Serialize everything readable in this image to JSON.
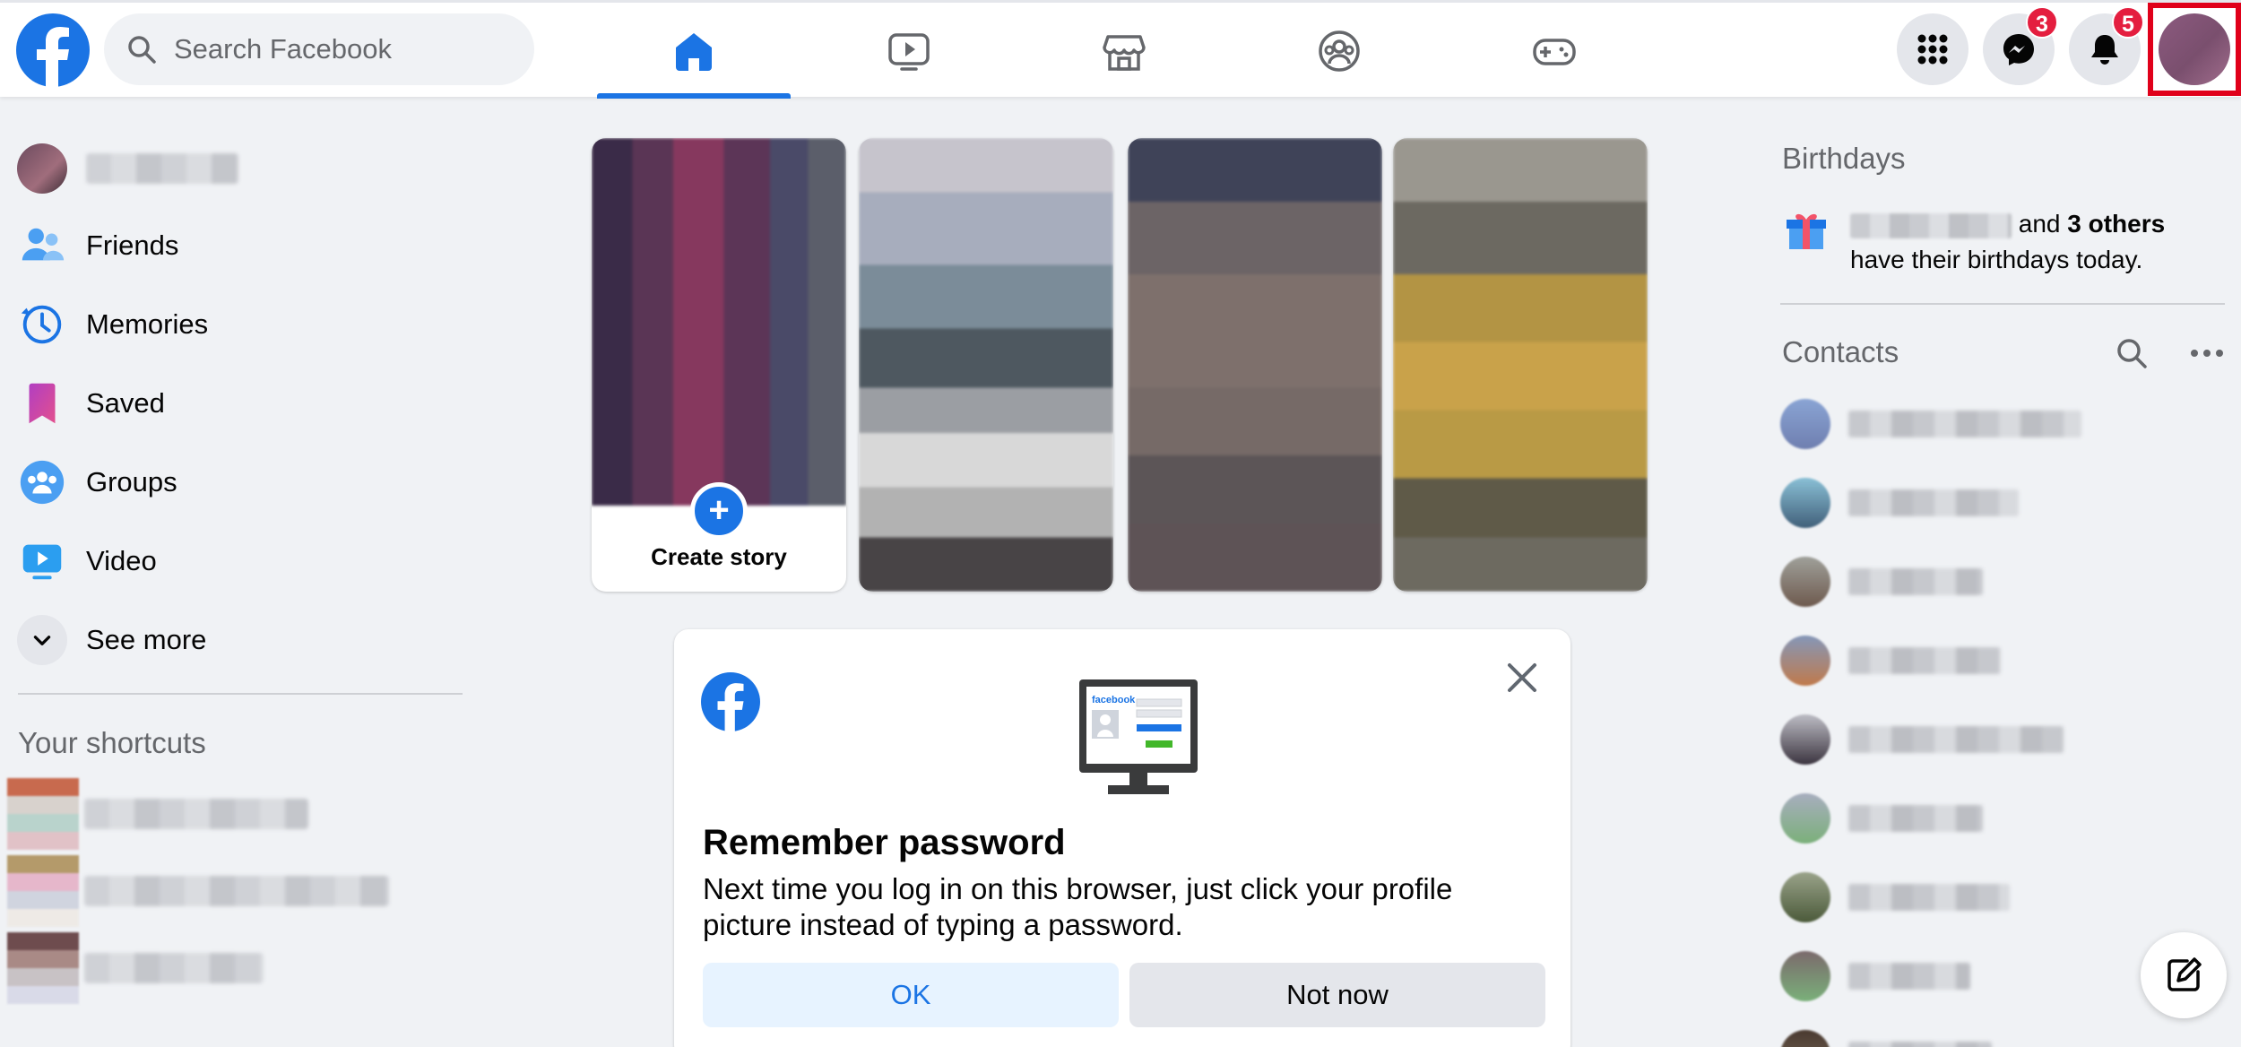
{
  "header": {
    "search_placeholder": "Search Facebook",
    "messenger_badge": "3",
    "notifications_badge": "5",
    "nav_tabs": [
      "home-icon",
      "watch-icon",
      "marketplace-icon",
      "groups-icon",
      "gaming-icon"
    ],
    "active_tab": "home"
  },
  "left_nav": {
    "items": [
      {
        "label": "Friends",
        "icon": "friends-icon"
      },
      {
        "label": "Memories",
        "icon": "memories-icon"
      },
      {
        "label": "Saved",
        "icon": "saved-icon"
      },
      {
        "label": "Groups",
        "icon": "groups-icon"
      },
      {
        "label": "Video",
        "icon": "video-icon"
      }
    ],
    "see_more": "See more",
    "shortcuts_title": "Your shortcuts"
  },
  "stories": {
    "create_label": "Create story",
    "create_plus": "+"
  },
  "remember_password": {
    "title": "Remember password",
    "body": "Next time you log in on this browser, just click your profile picture instead of typing a password.",
    "ok_label": "OK",
    "not_now_label": "Not now",
    "illustration_brand": "facebook"
  },
  "right_col": {
    "birthdays_title": "Birthdays",
    "birthday_and": "and",
    "birthday_others": "3 others",
    "birthday_rest": "have their birthdays today.",
    "contacts_title": "Contacts"
  },
  "colors": {
    "brand_blue": "#1b74e4",
    "badge_red": "#e41e3f",
    "page_bg": "#f0f2f5"
  }
}
